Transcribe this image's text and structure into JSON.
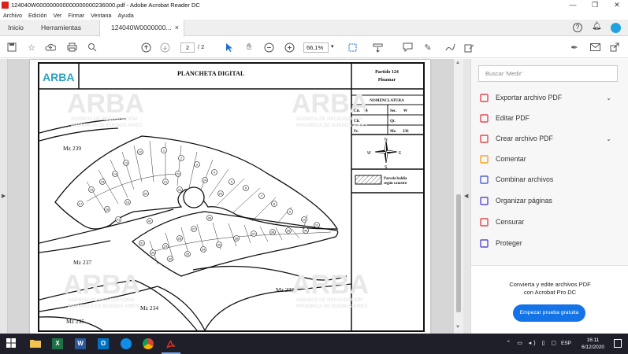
{
  "window": {
    "title": "124040W000000000000000000236000.pdf - Adobe Acrobat Reader DC",
    "controls": {
      "minimize": "—",
      "maximize": "❐",
      "close": "✕"
    }
  },
  "menu": [
    "Archivo",
    "Edición",
    "Ver",
    "Firmar",
    "Ventana",
    "Ayuda"
  ],
  "tabs": {
    "home": "Inicio",
    "tools": "Herramientas",
    "document": "124040W0000000...",
    "close": "×"
  },
  "toolbar": {
    "page_current": "2",
    "page_total": "/  2",
    "zoom": "66,1%"
  },
  "document": {
    "logo": "ARBA",
    "heading": "PLANCHETA DIGITAL",
    "partido_line1": "Partido 124",
    "partido_line2": "Pinamar",
    "nomenclatura": "NOMENCLATURA",
    "cir_label": "Cir.",
    "cir_value": "4",
    "sec_label": "Sec.",
    "sec_value": "W",
    "ch_label": "Ch.",
    "qt_label": "Qt.",
    "fr_label": "Fr.",
    "mz_label": "Mz.",
    "mz_value": "236",
    "compass": {
      "n": "N",
      "s": "S",
      "e": "E",
      "w": "W"
    },
    "legend_line1": "Parcela baldía",
    "legend_line2": "según catastro",
    "watermark": "ARBA",
    "watermark_sub1": "AGENCIA DE RECAUDACIÓN",
    "watermark_sub2": "PROVINCIA DE BUENOS AIRES",
    "blocks": [
      "Mz 239",
      "Mz 237",
      "Mz 233",
      "Mz 234",
      "Mz 235"
    ],
    "parcels": [
      "1",
      "2",
      "3",
      "4",
      "5",
      "6",
      "7",
      "8",
      "9",
      "10",
      "11",
      "12",
      "13",
      "14",
      "15",
      "16",
      "17",
      "18",
      "19",
      "20",
      "21",
      "22",
      "23",
      "24",
      "25",
      "26",
      "27",
      "28",
      "29",
      "30",
      "31",
      "32",
      "33",
      "34",
      "35",
      "36",
      "37",
      "38",
      "39",
      "40",
      "41",
      "42"
    ]
  },
  "panel": {
    "search_placeholder": "Buscar 'Medir'",
    "tools": [
      {
        "label": "Exportar archivo PDF",
        "icon": "export-pdf-icon",
        "color": "#e34850",
        "chevron": "⌄"
      },
      {
        "label": "Editar PDF",
        "icon": "edit-pdf-icon",
        "color": "#e34850",
        "chevron": ""
      },
      {
        "label": "Crear archivo PDF",
        "icon": "create-pdf-icon",
        "color": "#e34850",
        "chevron": "⌄"
      },
      {
        "label": "Comentar",
        "icon": "comment-icon",
        "color": "#f5a623",
        "chevron": ""
      },
      {
        "label": "Combinar archivos",
        "icon": "combine-files-icon",
        "color": "#4b63d8",
        "chevron": ""
      },
      {
        "label": "Organizar páginas",
        "icon": "organize-pages-icon",
        "color": "#5a4ed1",
        "chevron": ""
      },
      {
        "label": "Censurar",
        "icon": "redact-icon",
        "color": "#e34850",
        "chevron": ""
      },
      {
        "label": "Proteger",
        "icon": "protect-icon",
        "color": "#5a4ed1",
        "chevron": ""
      }
    ],
    "promo_line1": "Convierta y edite archivos PDF",
    "promo_line2": "con Acrobat Pro DC",
    "trial_button": "Empezar prueba gratuita"
  },
  "taskbar": {
    "lang": "ESP",
    "time": "16:11",
    "date": "6/12/2020"
  }
}
